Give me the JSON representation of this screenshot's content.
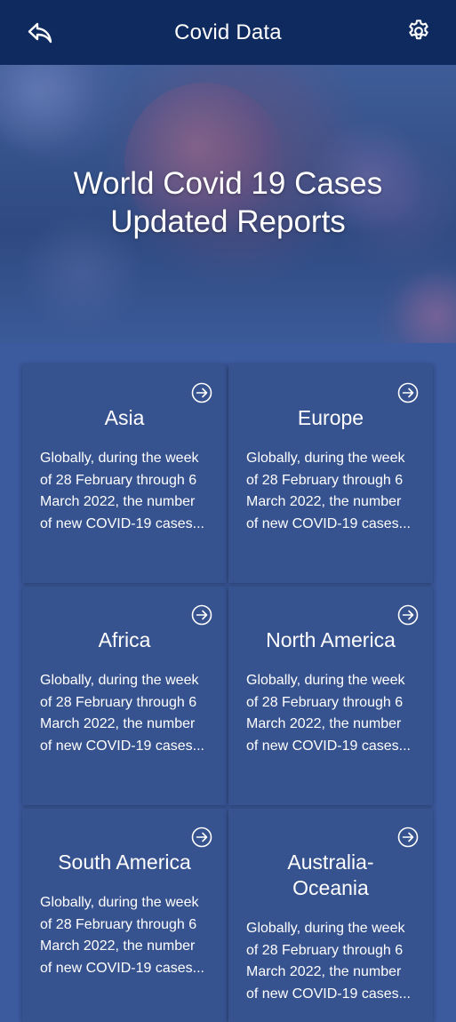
{
  "header": {
    "title": "Covid Data",
    "back_icon": "reply-arrow-icon",
    "settings_icon": "gear-icon"
  },
  "hero": {
    "title_line1": "World Covid 19 Cases",
    "title_line2": "Updated Reports"
  },
  "regions": [
    {
      "name": "Asia",
      "description": "Globally, during the week of 28 February through 6 March 2022, the number of new COVID-19 cases..."
    },
    {
      "name": "Europe",
      "description": "Globally, during the week of 28 February through 6 March 2022, the number of new COVID-19 cases..."
    },
    {
      "name": "Africa",
      "description": "Globally, during the week of 28 February through 6 March 2022, the number of new COVID-19 cases..."
    },
    {
      "name": "North America",
      "description": "Globally, during the week of 28 February through 6 March 2022, the number of new COVID-19 cases..."
    },
    {
      "name": "South America",
      "description": "Globally, during the week of 28 February through 6 March 2022, the number of new COVID-19 cases..."
    },
    {
      "name": "Australia-Oceania",
      "description": "Globally, during the week of 28 February through 6 March 2022, the number of new COVID-19 cases..."
    }
  ],
  "colors": {
    "header_bg": "#0f2a5e",
    "page_bg": "#3c5a9e",
    "card_bg": "#36528f",
    "text": "#ffffff"
  }
}
